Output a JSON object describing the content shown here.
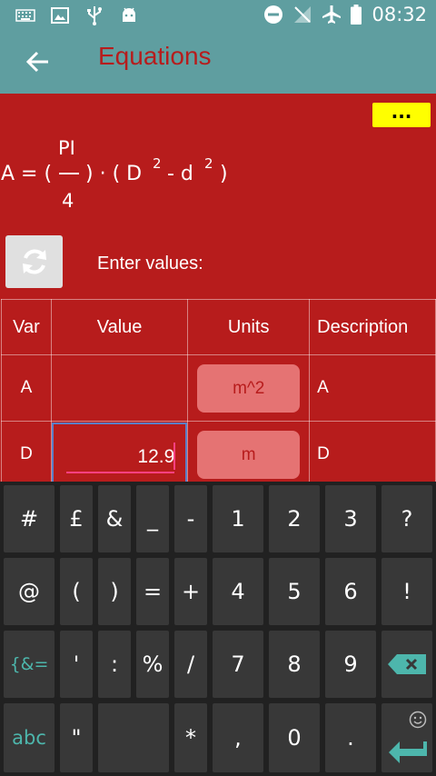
{
  "status_bar": {
    "time": "08:32",
    "icons_left": [
      "keyboard-icon",
      "image-icon",
      "usb-icon",
      "android-debug-icon"
    ],
    "icons_right": [
      "do-not-disturb-icon",
      "no-signal-icon",
      "airplane-mode-icon",
      "battery-icon"
    ]
  },
  "app_bar": {
    "title": "Equations",
    "back_icon": "arrow-back-icon"
  },
  "content": {
    "more_button_label": "...",
    "formula": {
      "lhs": "A = (",
      "numerator": "PI",
      "denominator": "4",
      "rhs_part1": ") · ( D",
      "exp1": "2",
      "minus": "- d",
      "exp2": "2",
      "close": ")"
    },
    "refresh_icon": "refresh-icon",
    "enter_values_label": "Enter values:",
    "table": {
      "headers": [
        "Var",
        "Value",
        "Units",
        "Description"
      ],
      "rows": [
        {
          "var": "A",
          "value": "",
          "unit": "m^2",
          "description": "A"
        },
        {
          "var": "D",
          "value": "12.9",
          "unit": "m",
          "description": "D"
        }
      ]
    },
    "colors": {
      "background": "#b71c1c",
      "accent_bar": "#5f9ea0",
      "more_button": "#ffff00",
      "unit_button": "#e57373",
      "focus_underline": "#ff4081"
    }
  },
  "keyboard": {
    "row1": [
      "#",
      "£",
      "&",
      "_",
      "-",
      "1",
      "2",
      "3",
      "?"
    ],
    "row2": [
      "@",
      "(",
      ")",
      "=",
      "+",
      "4",
      "5",
      "6",
      "!"
    ],
    "row3": [
      "{&=",
      "'",
      ":",
      "%",
      "/",
      "7",
      "8",
      "9",
      "backspace-icon"
    ],
    "row4": [
      "abc",
      "\"",
      "",
      "*",
      ",",
      "0",
      ".",
      "enter-icon"
    ],
    "emoji_icon": "smiley-icon"
  }
}
